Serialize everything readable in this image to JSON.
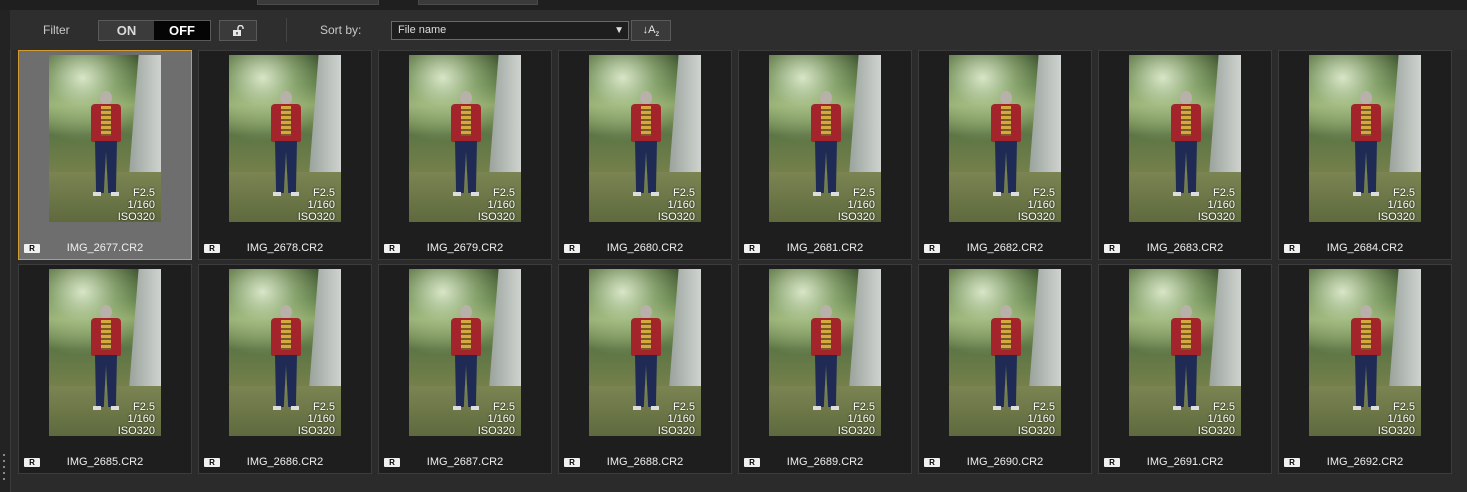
{
  "toolbar": {
    "filter_label": "Filter",
    "toggle_on": "ON",
    "toggle_off": "OFF",
    "lock_icon": "unlock-icon",
    "sort_label": "Sort by:",
    "sort_value": "File name",
    "sort_direction_icon": "sort-ascending-az-icon",
    "sort_direction_text": "A",
    "sort_direction_sub": "z"
  },
  "thumbnails": [
    {
      "file": "IMG_2677.CR2",
      "aperture": "F2.5",
      "shutter": "1/160",
      "iso": "ISO320",
      "badge": "R",
      "selected": true
    },
    {
      "file": "IMG_2678.CR2",
      "aperture": "F2.5",
      "shutter": "1/160",
      "iso": "ISO320",
      "badge": "R",
      "selected": false
    },
    {
      "file": "IMG_2679.CR2",
      "aperture": "F2.5",
      "shutter": "1/160",
      "iso": "ISO320",
      "badge": "R",
      "selected": false
    },
    {
      "file": "IMG_2680.CR2",
      "aperture": "F2.5",
      "shutter": "1/160",
      "iso": "ISO320",
      "badge": "R",
      "selected": false
    },
    {
      "file": "IMG_2681.CR2",
      "aperture": "F2.5",
      "shutter": "1/160",
      "iso": "ISO320",
      "badge": "R",
      "selected": false
    },
    {
      "file": "IMG_2682.CR2",
      "aperture": "F2.5",
      "shutter": "1/160",
      "iso": "ISO320",
      "badge": "R",
      "selected": false
    },
    {
      "file": "IMG_2683.CR2",
      "aperture": "F2.5",
      "shutter": "1/160",
      "iso": "ISO320",
      "badge": "R",
      "selected": false
    },
    {
      "file": "IMG_2684.CR2",
      "aperture": "F2.5",
      "shutter": "1/160",
      "iso": "ISO320",
      "badge": "R",
      "selected": false
    },
    {
      "file": "IMG_2685.CR2",
      "aperture": "F2.5",
      "shutter": "1/160",
      "iso": "ISO320",
      "badge": "R",
      "selected": false
    },
    {
      "file": "IMG_2686.CR2",
      "aperture": "F2.5",
      "shutter": "1/160",
      "iso": "ISO320",
      "badge": "R",
      "selected": false
    },
    {
      "file": "IMG_2687.CR2",
      "aperture": "F2.5",
      "shutter": "1/160",
      "iso": "ISO320",
      "badge": "R",
      "selected": false
    },
    {
      "file": "IMG_2688.CR2",
      "aperture": "F2.5",
      "shutter": "1/160",
      "iso": "ISO320",
      "badge": "R",
      "selected": false
    },
    {
      "file": "IMG_2689.CR2",
      "aperture": "F2.5",
      "shutter": "1/160",
      "iso": "ISO320",
      "badge": "R",
      "selected": false
    },
    {
      "file": "IMG_2690.CR2",
      "aperture": "F2.5",
      "shutter": "1/160",
      "iso": "ISO320",
      "badge": "R",
      "selected": false
    },
    {
      "file": "IMG_2691.CR2",
      "aperture": "F2.5",
      "shutter": "1/160",
      "iso": "ISO320",
      "badge": "R",
      "selected": false
    },
    {
      "file": "IMG_2692.CR2",
      "aperture": "F2.5",
      "shutter": "1/160",
      "iso": "ISO320",
      "badge": "R",
      "selected": false
    }
  ],
  "colors": {
    "selection_border": "#d49b33",
    "selected_background": "#6e6e6e",
    "background": "#2b2b2b"
  }
}
